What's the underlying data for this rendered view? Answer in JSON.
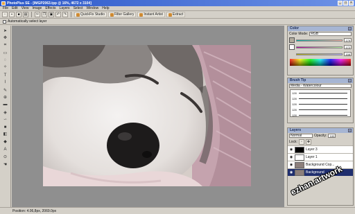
{
  "window": {
    "title": "PhotoPlus SE - [IMGP2063.tpp @ 16%, 4672 x 3104]",
    "controls": [
      "_",
      "□",
      "×"
    ]
  },
  "menubar": [
    "File",
    "Edit",
    "View",
    "Image",
    "Effects",
    "Layers",
    "Select",
    "Window",
    "Help"
  ],
  "toolbar": {
    "quickfix": "QuickFix Studio",
    "filter_gallery": "Filter Gallery",
    "instant_artist": "Instant Artist",
    "extract": "Extract"
  },
  "options": {
    "auto_select": "Automatically select layer"
  },
  "status": {
    "text": "Position: 4.06,8px, 2069.0px"
  },
  "color_panel": {
    "title": "Color",
    "mode_label": "Color Mode:",
    "mode": "RGB",
    "r": "179",
    "g": "172",
    "b": "158"
  },
  "brush_panel": {
    "title": "Brush Tip",
    "category": "Media - Watercolour",
    "sizes": [
      "128",
      "128",
      "128",
      "128",
      "128"
    ]
  },
  "layers_panel": {
    "title": "Layers",
    "blend": "Normal",
    "opacity_label": "Opacity:",
    "opacity": "100",
    "lock": "Lock:",
    "layers": [
      {
        "name": "Layer 3"
      },
      {
        "name": "Layer 1"
      },
      {
        "name": "Background Cop..."
      },
      {
        "name": "Background"
      }
    ]
  },
  "watermark": "ezhan.artwork",
  "colors": {
    "accent": "#2a56c8",
    "canvas": "#8f8f8f"
  }
}
